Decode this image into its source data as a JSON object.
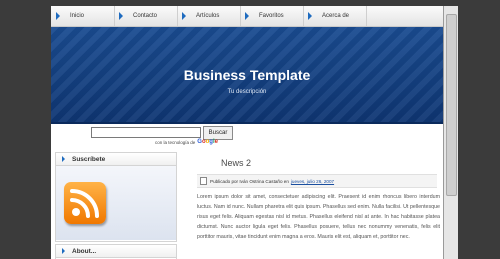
{
  "nav": {
    "items": [
      {
        "label": "Inicio"
      },
      {
        "label": "Contacto"
      },
      {
        "label": "Artículos"
      },
      {
        "label": "Favoritos"
      },
      {
        "label": "Acerca de"
      }
    ]
  },
  "banner": {
    "title": "Business Template",
    "subtitle": "Tu descripción"
  },
  "search": {
    "input_value": "",
    "button_label": "Buscar",
    "powered_by": "con la tecnología de",
    "powered_brand": "Google"
  },
  "sidebar": {
    "subscribe_title": "Suscríbete",
    "about_title": "About..."
  },
  "post": {
    "title": "News 2",
    "meta_prefix": "Publicado por Iván Ostrina Castaño en",
    "meta_date": "jueves, julio 26, 2007",
    "body": "Lorem ipsum dolor sit amet, consectetuer adipiscing elit. Praesent id enim rhoncus libero interdum luctus. Nam id nunc. Nullam pharetra elit quis ipsum. Phasellus sed enim. Nulla facilisi. Ut pellentesque risus eget felis. Aliquam egestas nisl id metus. Phasellus eleifend nisl at ante. In hac habitasse platea dictumst. Nunc auctor ligula eget felis. Phasellus posuere, tellus nec nonummy venenatis, felis elit porttitor mauris, vitae tincidunt enim magna a eros. Mauris elit est, aliquam et, porttitor nec."
  },
  "colors": {
    "banner": "#12387a",
    "accent": "#1e6bbf",
    "rss": "#f07800"
  }
}
